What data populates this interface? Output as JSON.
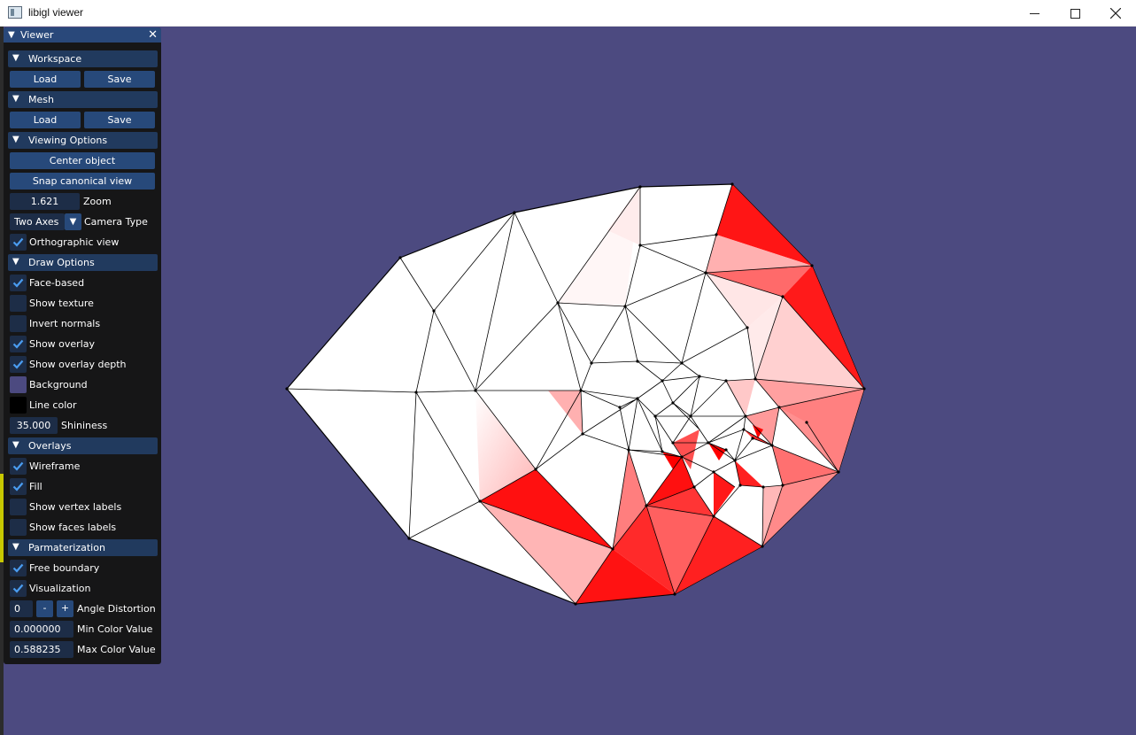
{
  "window": {
    "title": "libigl viewer"
  },
  "colors": {
    "background": "#4c4a80",
    "mesh_red": "#ff0000",
    "line": "#000000",
    "panel": "#161617",
    "header": "#213a5e",
    "button": "#27497a"
  },
  "panel": {
    "title": "Viewer",
    "workspace": {
      "header": "Workspace",
      "load": "Load",
      "save": "Save"
    },
    "mesh": {
      "header": "Mesh",
      "load": "Load",
      "save": "Save"
    },
    "viewing": {
      "header": "Viewing Options",
      "center": "Center object",
      "snap": "Snap canonical view",
      "zoom_value": "1.621",
      "zoom_label": "Zoom",
      "camera_value": "Two Axes",
      "camera_label": "Camera Type",
      "ortho_label": "Orthographic view",
      "ortho_checked": true
    },
    "draw": {
      "header": "Draw Options",
      "face_based": "Face-based",
      "show_texture": "Show texture",
      "invert_normals": "Invert normals",
      "show_overlay": "Show overlay",
      "show_overlay_depth": "Show overlay depth",
      "background": "Background",
      "line_color": "Line color",
      "shininess_value": "35.000",
      "shininess_label": "Shininess"
    },
    "overlays": {
      "header": "Overlays",
      "wireframe": "Wireframe",
      "fill": "Fill",
      "vertex_labels": "Show vertex labels",
      "face_labels": "Show faces labels"
    },
    "param": {
      "header": "Parmaterization",
      "free_boundary": "Free boundary",
      "visualization": "Visualization",
      "angle_value": "0",
      "minus": "-",
      "plus": "+",
      "angle_label": "Angle Distortion",
      "min_value": "0.000000",
      "min_label": "Min Color Value",
      "max_value": "0.588235",
      "max_label": "Max Color Value"
    }
  }
}
